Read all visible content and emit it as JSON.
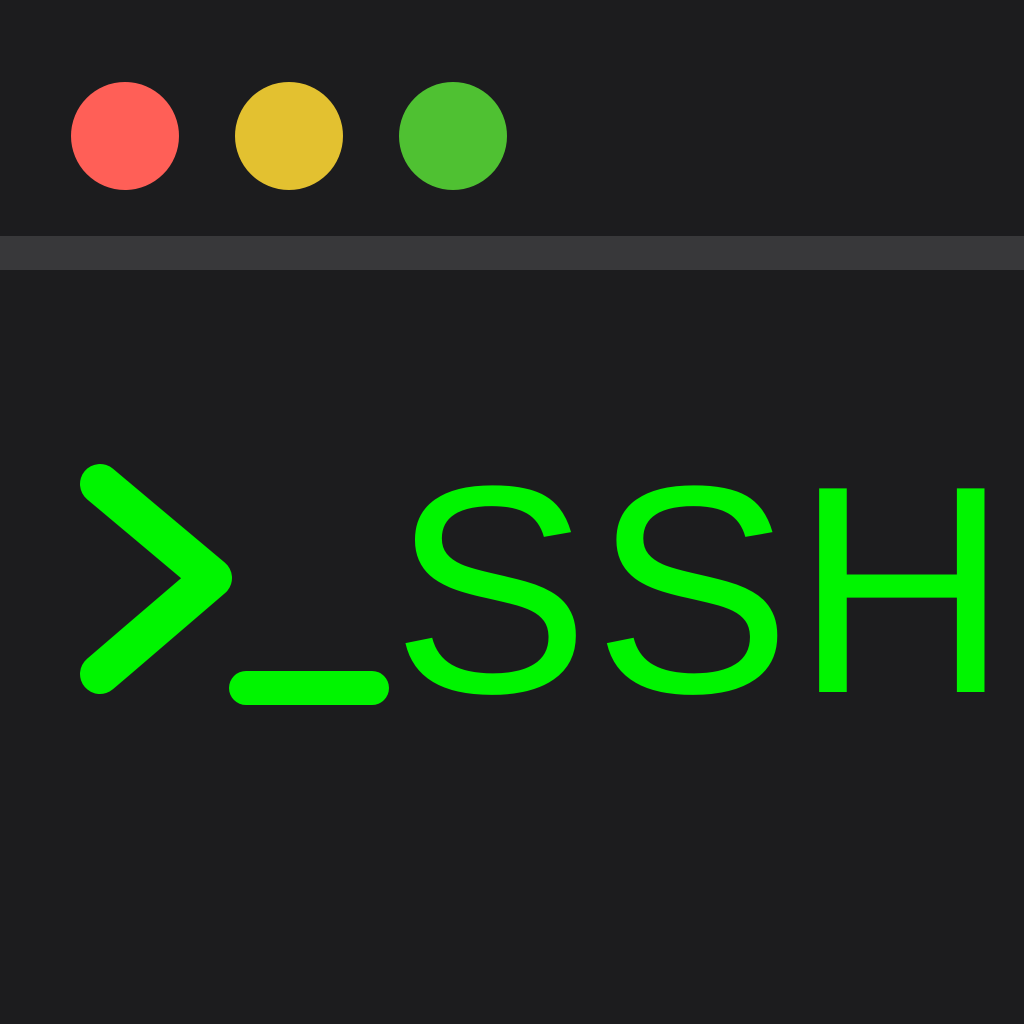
{
  "window": {
    "background": "#1c1c1e",
    "divider_color": "#38383a"
  },
  "traffic_lights": [
    {
      "name": "close",
      "color": "#ff5f57"
    },
    {
      "name": "minimize",
      "color": "#e3c130"
    },
    {
      "name": "zoom",
      "color": "#4fc132"
    }
  ],
  "terminal": {
    "prompt_icon": "chevron-right-icon",
    "cursor_icon": "underscore-cursor-icon",
    "text": "SSH",
    "text_color": "#00f500"
  }
}
